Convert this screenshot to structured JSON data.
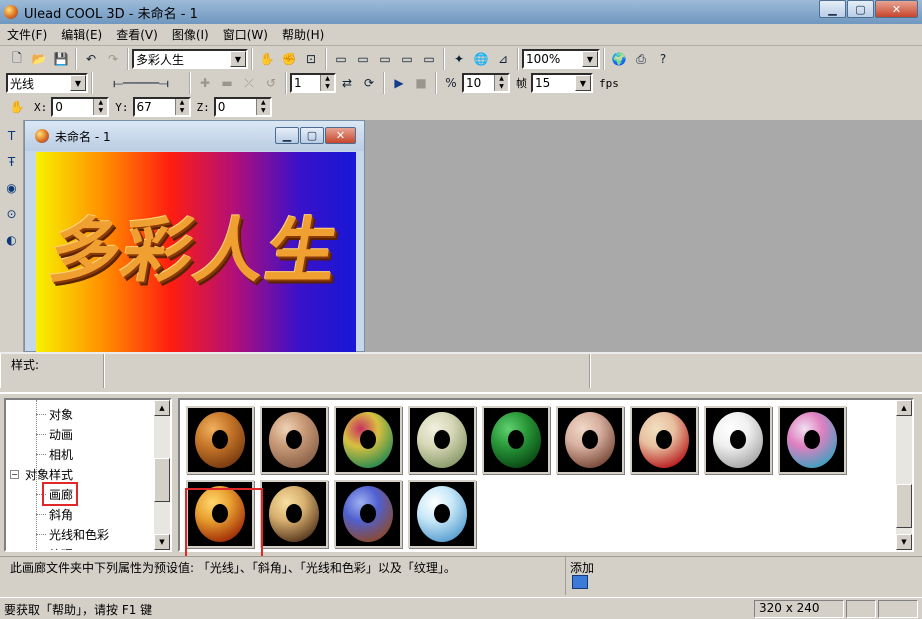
{
  "window": {
    "title": "Ulead COOL 3D - 未命名 - 1"
  },
  "menu": [
    "文件(F)",
    "编辑(E)",
    "查看(V)",
    "图像(I)",
    "窗口(W)",
    "帮助(H)"
  ],
  "toolbar1": {
    "text_combo": "多彩人生",
    "zoom_combo": "100%"
  },
  "toolbar2": {
    "object_combo": "光线",
    "frame_value": "1",
    "fps_total": "10",
    "frame_label": "帧",
    "fps_value": "15",
    "fps_label": "fps"
  },
  "toolbar3": {
    "x_label": "X:",
    "x_value": "0",
    "y_label": "Y:",
    "y_value": "67",
    "z_label": "Z:",
    "z_value": "0"
  },
  "document": {
    "title": "未命名 - 1",
    "canvas_text": "多彩人生"
  },
  "stylebar": {
    "label": "样式:"
  },
  "tree": {
    "items": [
      "对象",
      "动画",
      "相机"
    ],
    "group": "对象样式",
    "sub_items": [
      "画廊",
      "斜角",
      "光线和色彩",
      "纹理"
    ]
  },
  "gallery": {
    "thumbs": [
      {
        "name": "wood",
        "colors": [
          "#c8782a",
          "#7a3a10",
          "#f0b060"
        ]
      },
      {
        "name": "sand",
        "colors": [
          "#c89a78",
          "#8a6248",
          "#f0d2b6"
        ]
      },
      {
        "name": "stripes",
        "colors": [
          "#d8c040",
          "#2a8a50",
          "#c83060"
        ]
      },
      {
        "name": "marble-green",
        "colors": [
          "#d8d8b8",
          "#8a9a6a",
          "#f0f0e0"
        ]
      },
      {
        "name": "malachite",
        "colors": [
          "#2a9a3a",
          "#0a4a14",
          "#60d070"
        ]
      },
      {
        "name": "granite",
        "colors": [
          "#d8b0a0",
          "#7a4a3a",
          "#f0d8c8"
        ]
      },
      {
        "name": "floral",
        "colors": [
          "#e8c0a0",
          "#b82020",
          "#f0e0c0"
        ]
      },
      {
        "name": "white-marble",
        "colors": [
          "#f0f0f0",
          "#a8a8a8",
          "#ffffff"
        ]
      },
      {
        "name": "gradient-metal",
        "colors": [
          "#e080c0",
          "#40a0c0",
          "#f0e0f0"
        ]
      },
      {
        "name": "fire-gold",
        "colors": [
          "#e8a030",
          "#a02c08",
          "#ffd870"
        ]
      },
      {
        "name": "leopard",
        "colors": [
          "#d8b070",
          "#5a3a20",
          "#f8e0a0"
        ]
      },
      {
        "name": "blue-wood",
        "colors": [
          "#5060d0",
          "#8a4a30",
          "#a0b0f0"
        ]
      },
      {
        "name": "ice",
        "colors": [
          "#c8e8f8",
          "#5aa0d0",
          "#ffffff"
        ]
      }
    ]
  },
  "description": {
    "text": "此画廊文件夹中下列属性为预设值: 「光线」、「斜角」、「光线和色彩」以及「纹理」。",
    "add_label": "添加"
  },
  "status": {
    "help": "要获取「帮助」，请按 F1 键",
    "size": "320 x 240"
  }
}
